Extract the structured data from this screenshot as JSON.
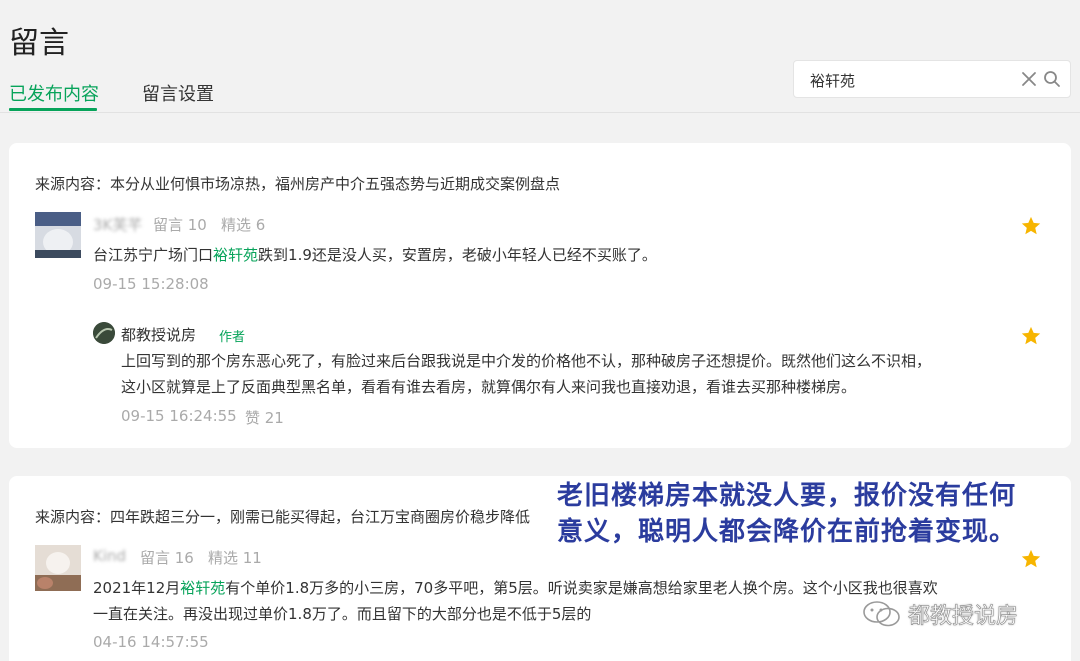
{
  "page": {
    "title": "留言"
  },
  "tabs": [
    {
      "label": "已发布内容",
      "active": true
    },
    {
      "label": "留言设置",
      "active": false
    }
  ],
  "search": {
    "value": "裕轩苑",
    "placeholder": ""
  },
  "colors": {
    "accent": "#07a35a",
    "star": "#f7b500",
    "overlay_text": "#2b3c9e"
  },
  "icons": {
    "clear": "close-icon",
    "search": "search-icon",
    "star": "star-icon"
  },
  "cards": [
    {
      "source": "来源内容：本分从业何惧市场凉热，福州房产中介五强态势与近期成交案例盘点",
      "comment": {
        "user": "3K芙芊",
        "count_label": "留言 10",
        "picked_label": "精选 6",
        "text_pre": "台江苏宁广场门口",
        "text_hl": "裕轩苑",
        "text_post": "跌到1.9还是没人买，安置房，老破小年轻人已经不买账了。",
        "time": "09-15 15:28:08"
      },
      "reply": {
        "author": "都教授说房",
        "badge": "作者",
        "line1": "上回写到的那个房东恶心死了，有脸过来后台跟我说是中介发的价格他不认，那种破房子还想提价。既然他们这么不识相，",
        "line2": "这小区就算是上了反面典型黑名单，看看有谁去看房，就算偶尔有人来问我也直接劝退，看谁去买那种楼梯房。",
        "time": "09-15 16:24:55",
        "likes": "赞 21"
      }
    },
    {
      "source": "来源内容：四年跌超三分一，刚需已能买得起，台江万宝商圈房价稳步降低",
      "comment": {
        "user": "Kind",
        "count_label": "留言 16",
        "picked_label": "精选 11",
        "text_pre": "2021年12月",
        "text_hl": "裕轩苑",
        "text_post": "有个单价1.8万多的小三房，70多平吧，第5层。听说卖家是嫌高想给家里老人换个房。这个小区我也很喜欢",
        "line2": "一直在关注。再没出现过单价1.8万了。而且留下的大部分也是不低于5层的",
        "time": "04-16 14:57:55"
      }
    }
  ],
  "overlay": {
    "line1": "老旧楼梯房本就没人要，报价没有任何",
    "line2": "意义，聪明人都会降价在前抢着变现。"
  },
  "watermark": {
    "text": "都教授说房"
  }
}
